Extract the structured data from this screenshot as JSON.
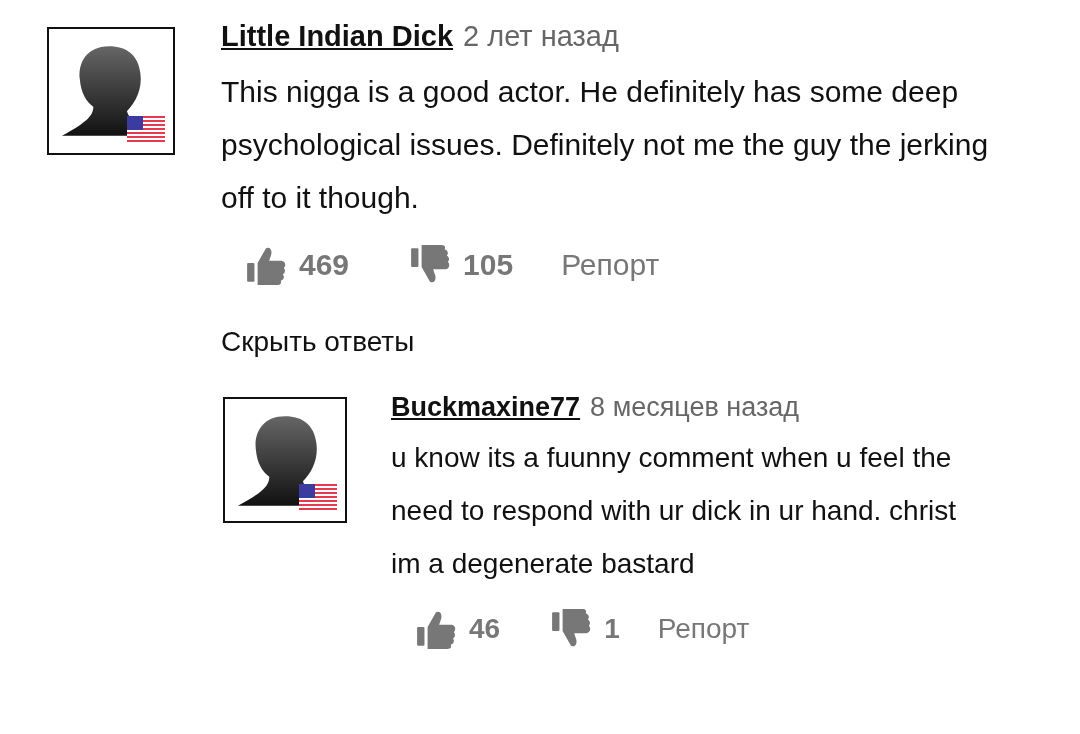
{
  "comments": [
    {
      "author": "Little Indian Dick",
      "time": "2 лет назад",
      "text": "This nigga is a good actor. He definitely has some deep psychological issues. Definitely not me the guy the jerking off to it though.",
      "likes": "469",
      "dislikes": "105",
      "report": "Репорт",
      "toggle_replies": "Скрыть ответы",
      "replies": [
        {
          "author": "Buckmaxine77",
          "time": "8 месяцев назад",
          "text": "u know its a fuunny comment when u feel the need to respond with ur dick in ur hand. christ im a degenerate bastard",
          "likes": "46",
          "dislikes": "1",
          "report": "Репорт"
        }
      ]
    }
  ]
}
